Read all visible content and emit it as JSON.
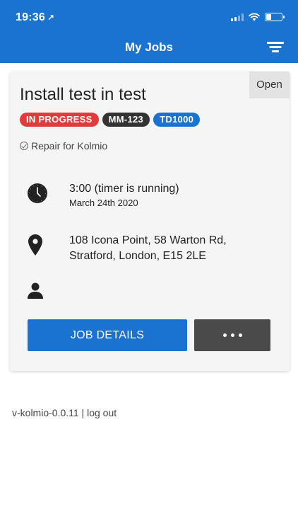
{
  "status_bar": {
    "time": "19:36",
    "location_glyph": "↗"
  },
  "header": {
    "title": "My Jobs"
  },
  "job": {
    "status_tag": "Open",
    "title": "Install test in test",
    "badges": [
      {
        "label": "IN PROGRESS",
        "color": "#e23b3b"
      },
      {
        "label": "MM-123",
        "color": "#333333"
      },
      {
        "label": "TD1000",
        "color": "#1a73d1"
      }
    ],
    "repair_for": "Repair for Kolmio",
    "time": {
      "main": "3:00 (timer is running)",
      "date": "March 24th 2020"
    },
    "address_line1": "108 Icona Point, 58 Warton Rd,",
    "address_line2": "Stratford, London, E15 2LE",
    "buttons": {
      "details": "JOB DETAILS"
    }
  },
  "footer": {
    "version": "v-kolmio-0.0.11",
    "separator": " | ",
    "logout": "log out"
  },
  "colors": {
    "brand": "#1a73d1",
    "card_bg": "#f5f5f5"
  },
  "icons": [
    "location-arrow-icon",
    "signal-icon",
    "wifi-icon",
    "battery-icon",
    "filter-icon",
    "check-circle-icon",
    "clock-icon",
    "map-pin-icon",
    "person-icon",
    "more-dots-icon"
  ]
}
